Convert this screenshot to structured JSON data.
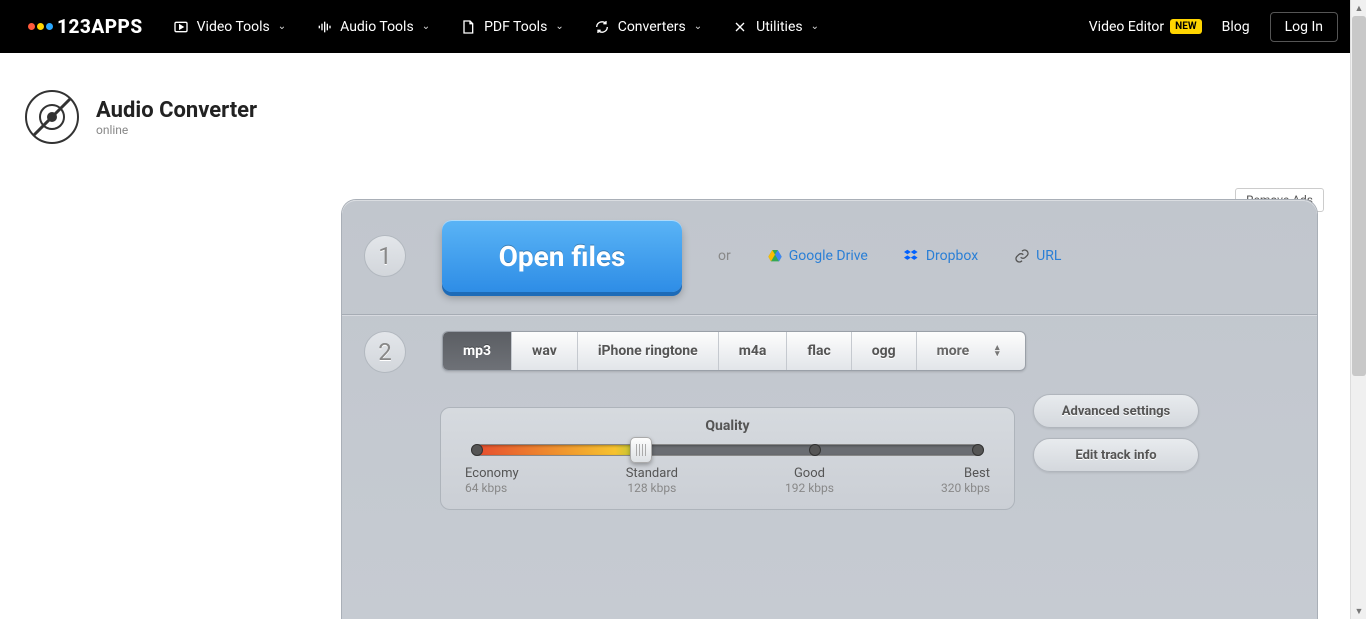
{
  "nav": {
    "brand": "123APPS",
    "items": [
      "Video Tools",
      "Audio Tools",
      "PDF Tools",
      "Converters",
      "Utilities"
    ],
    "video_editor": "Video Editor",
    "new_badge": "NEW",
    "blog": "Blog",
    "login": "Log In"
  },
  "app": {
    "title": "Audio Converter",
    "subtitle": "online"
  },
  "remove_ads": "Remove Ads",
  "step1": {
    "num": "1",
    "open": "Open files",
    "or": "or",
    "google_drive": "Google Drive",
    "dropbox": "Dropbox",
    "url": "URL"
  },
  "step2": {
    "num": "2",
    "formats": [
      "mp3",
      "wav",
      "iPhone ringtone",
      "m4a",
      "flac",
      "ogg",
      "more"
    ],
    "active_format": "mp3"
  },
  "quality": {
    "title": "Quality",
    "labels": [
      {
        "name": "Economy",
        "rate": "64 kbps"
      },
      {
        "name": "Standard",
        "rate": "128 kbps"
      },
      {
        "name": "Good",
        "rate": "192 kbps"
      },
      {
        "name": "Best",
        "rate": "320 kbps"
      }
    ],
    "selected_index": 1
  },
  "side": {
    "advanced": "Advanced settings",
    "edit_track": "Edit track info"
  }
}
